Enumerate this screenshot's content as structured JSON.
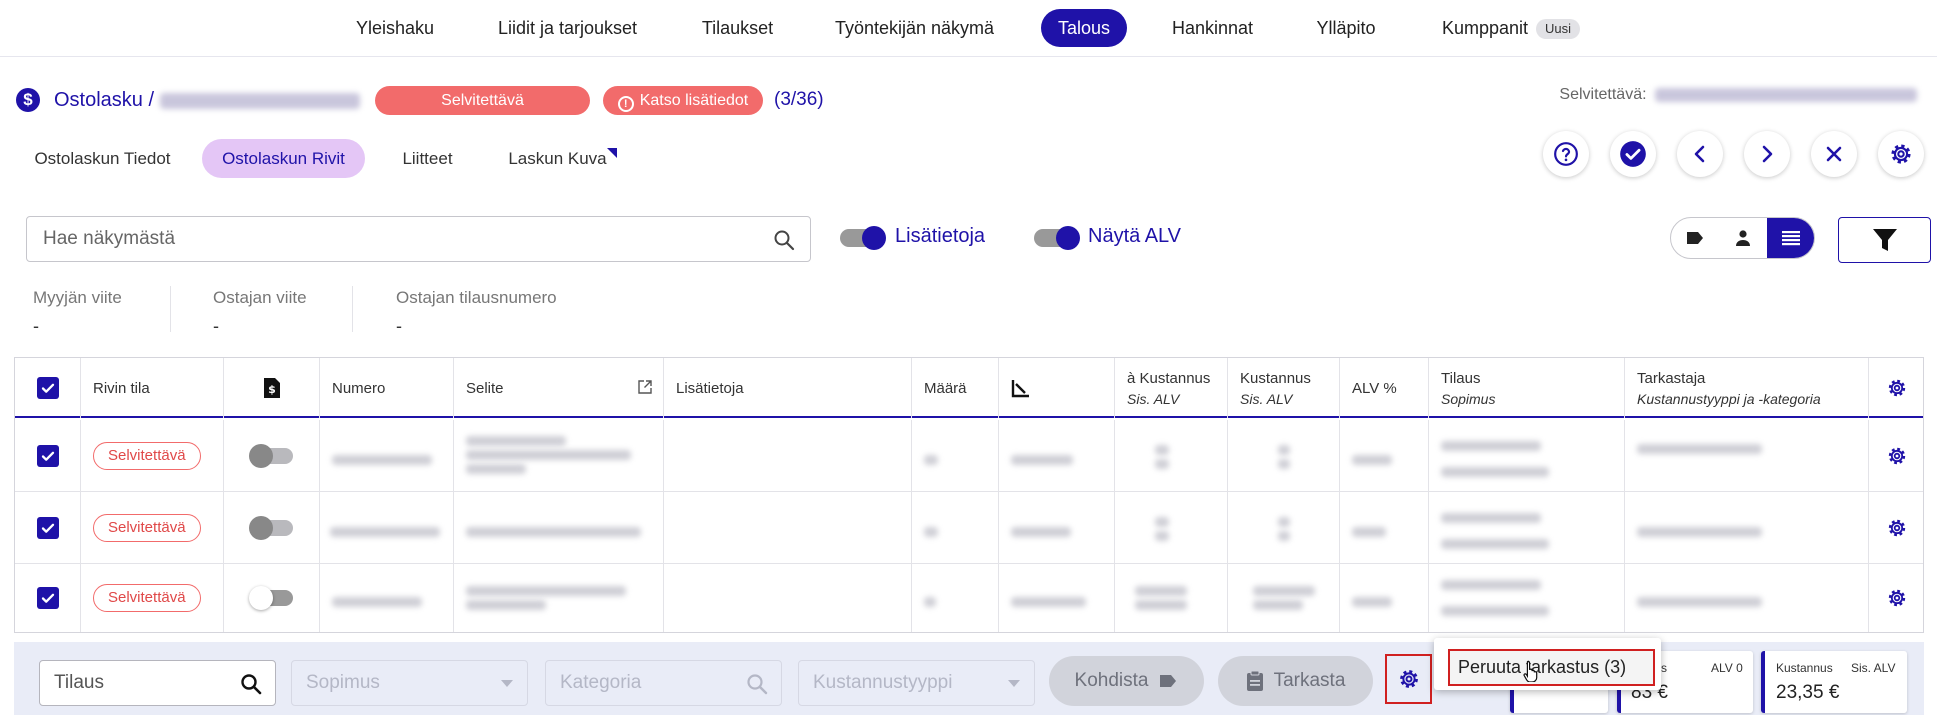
{
  "nav": {
    "items": [
      {
        "label": "Yleishaku"
      },
      {
        "label": "Liidit ja tarjoukset"
      },
      {
        "label": "Tilaukset"
      },
      {
        "label": "Työntekijän näkymä"
      },
      {
        "label": "Talous",
        "active": true
      },
      {
        "label": "Hankinnat"
      },
      {
        "label": "Ylläpito"
      },
      {
        "label": "Kumppanit",
        "badge": "Uusi"
      }
    ]
  },
  "header": {
    "breadcrumb_root": "Ostolasku",
    "breadcrumb_sep": "/",
    "status_pill": "Selvitettävä",
    "details_pill": "Katso lisätiedot",
    "details_icon": "!",
    "counter": "(3/36)",
    "right_status_label": "Selvitettävä:"
  },
  "tabs": [
    {
      "label": "Ostolaskun Tiedot"
    },
    {
      "label": "Ostolaskun Rivit",
      "active": true
    },
    {
      "label": "Liitteet"
    },
    {
      "label": "Laskun Kuva"
    }
  ],
  "toolbar": {
    "search_placeholder": "Hae näkymästä",
    "toggle_lisatietoja": "Lisätietoja",
    "toggle_alv": "Näytä ALV"
  },
  "refs": [
    {
      "label": "Myyjän viite",
      "value": "-"
    },
    {
      "label": "Ostajan viite",
      "value": "-"
    },
    {
      "label": "Ostajan tilausnumero",
      "value": "-"
    }
  ],
  "table": {
    "columns": [
      {
        "label": ""
      },
      {
        "label": "Rivin tila"
      },
      {
        "label": ""
      },
      {
        "label": "Numero"
      },
      {
        "label": "Selite"
      },
      {
        "label": "Lisätietoja"
      },
      {
        "label": "Määrä"
      },
      {
        "label": ""
      },
      {
        "label": "à Kustannus",
        "sub": "Sis. ALV"
      },
      {
        "label": "Kustannus",
        "sub": "Sis. ALV"
      },
      {
        "label": "ALV %"
      },
      {
        "label": "Tilaus",
        "sub": "Sopimus"
      },
      {
        "label": "Tarkastaja",
        "sub": "Kustannustyyppi ja -kategoria"
      },
      {
        "label": ""
      }
    ],
    "rows": [
      {
        "status": "Selvitettävä",
        "toggle": "off"
      },
      {
        "status": "Selvitettävä",
        "toggle": "off"
      },
      {
        "status": "Selvitettävä",
        "toggle": "off-light"
      }
    ]
  },
  "bottom": {
    "tilaus_placeholder": "Tilaus",
    "sopimus_placeholder": "Sopimus",
    "kategoria_placeholder": "Kategoria",
    "kustannustyyppi_placeholder": "Kustannustyyppi",
    "kohdista_label": "Kohdista",
    "tarkasta_label": "Tarkasta",
    "sum_alv0_label_a": "tannus",
    "sum_alv0_label_b": "ALV 0",
    "sum_alv0_value": "83 €",
    "sum_sis_label_a": "Kustannus",
    "sum_sis_label_b": "Sis. ALV",
    "sum_sis_value": "23,35 €"
  },
  "popup": {
    "item_label": "Peruuta tarkastus (3)"
  },
  "colors": {
    "primary": "#1f12a8",
    "danger": "#f26b6b",
    "tab_active_bg": "#e4c6f6",
    "highlight_red": "#d02020"
  }
}
